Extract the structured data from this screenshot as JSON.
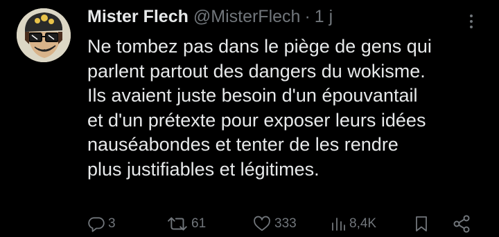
{
  "tweet": {
    "author_name": "Mister Flech",
    "handle": "@MisterFlech",
    "separator": "·",
    "time": "1 j",
    "body_lines": [
      "Ne tombez pas dans le piège de gens qui",
      "parlent partout des dangers du wokisme.",
      "Ils avaient juste besoin d'un épouvantail",
      "et d'un prétexte pour exposer leurs idées",
      "nauséabondes et tenter de les rendre",
      "plus justifiables et légitimes."
    ],
    "actions": {
      "replies": "3",
      "retweets": "61",
      "likes": "333",
      "views": "8,4K"
    }
  },
  "icons": {
    "more": "more-vertical-icon",
    "reply": "reply-icon",
    "retweet": "retweet-icon",
    "like": "heart-icon",
    "views": "views-chart-icon",
    "bookmark": "bookmark-icon",
    "share": "share-icon"
  },
  "colors": {
    "background": "#000000",
    "text_primary": "#e7e9ea",
    "text_secondary": "#71767b"
  }
}
